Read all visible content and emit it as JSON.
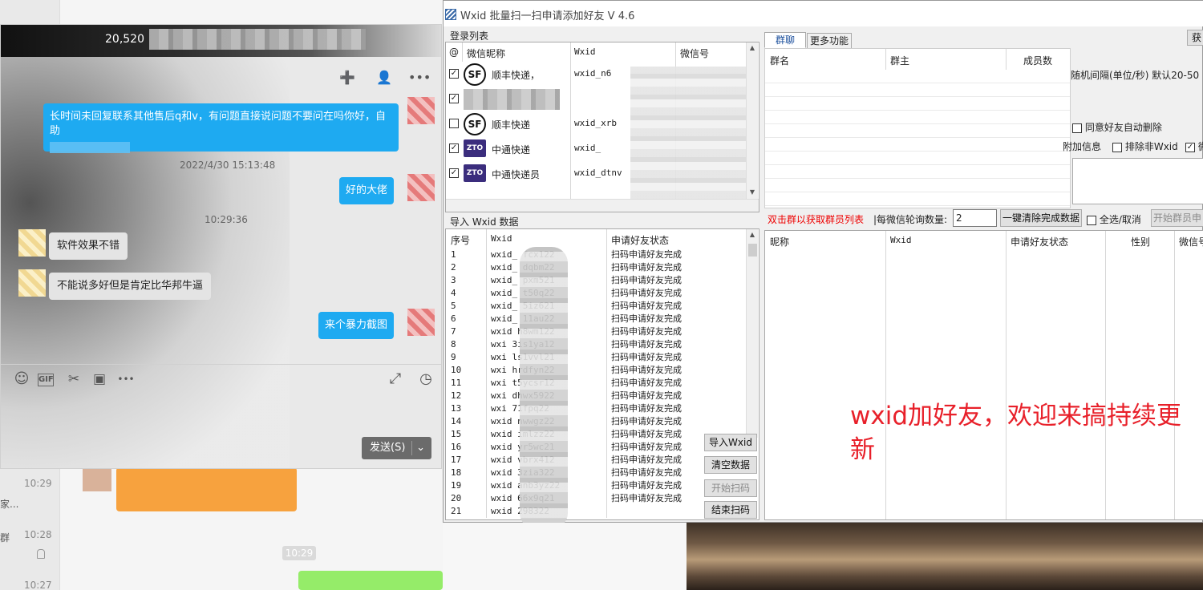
{
  "background_chat": {
    "times": [
      "10:29",
      "10:28",
      "10:27"
    ],
    "snippets": [
      "家...",
      "群"
    ],
    "pill_time": "10:29"
  },
  "chat": {
    "title": "20,520",
    "messages": [
      {
        "side": "right",
        "text": "长时间未回复联系其他售后q和v，有问题直接说问题不要问在吗你好，自助"
      },
      {
        "side": "stamp",
        "text": "2022/4/30 15:13:48"
      },
      {
        "side": "right",
        "text": "好的大佬"
      },
      {
        "side": "stamp",
        "text": "10:29:36"
      },
      {
        "side": "left",
        "text": "软件效果不错"
      },
      {
        "side": "left",
        "text": "不能说多好但是肯定比华邦牛逼"
      },
      {
        "side": "right",
        "text": "来个暴力截图"
      }
    ],
    "toolbar": {
      "emoji": "☺",
      "gif": "GIF",
      "scissors": "✂",
      "image": "▣",
      "more": "•••",
      "expand": "⤢",
      "history": "◷"
    },
    "header_icons": {
      "add_member": "➕",
      "profile": "👤",
      "more": "•••"
    },
    "send_label": "发送(S)",
    "send_arrow": "⌄"
  },
  "app": {
    "title": "Wxid 批量扫一扫申请添加好友 V 4.6",
    "login_list": {
      "label": "登录列表",
      "headers": [
        "@",
        "微信昵称",
        "Wxid",
        "微信号"
      ],
      "rows": [
        {
          "checked": true,
          "logo": "SF",
          "nick": "顺丰快递，",
          "wxid": "wxid_n6"
        },
        {
          "checked": true,
          "logo": "",
          "nick": "",
          "wxid": ""
        },
        {
          "checked": false,
          "logo": "SF",
          "nick": "顺丰快递",
          "wxid": "wxid_xrb"
        },
        {
          "checked": true,
          "logo": "ZTO",
          "nick": "中通快递",
          "wxid": "wxid_"
        },
        {
          "checked": true,
          "logo": "ZTO",
          "nick": "中通快递员",
          "wxid": "wxid_dtnv"
        }
      ]
    },
    "import": {
      "label": "导入 Wxid 数据",
      "headers": [
        "序号",
        "Wxid",
        "申请好友状态"
      ],
      "rows": [
        {
          "n": "1",
          "wxid": "wxid_      fcx122",
          "status": "扫码申请好友完成"
        },
        {
          "n": "2",
          "wxid": "wxid_      dqbm22",
          "status": "扫码申请好友完成"
        },
        {
          "n": "3",
          "wxid": "wxid_      pxm521",
          "status": "扫码申请好友完成"
        },
        {
          "n": "4",
          "wxid": "wxid_      t50q22",
          "status": "扫码申请好友完成"
        },
        {
          "n": "5",
          "wxid": "wxid_      5iz621",
          "status": "扫码申请好友完成"
        },
        {
          "n": "6",
          "wxid": "wxid_      11au22",
          "status": "扫码申请好友完成"
        },
        {
          "n": "7",
          "wxid": "wxid       h8wm122",
          "status": "扫码申请好友完成"
        },
        {
          "n": "8",
          "wxid": "wxi        3is1ya12",
          "status": "扫码申请好友完成"
        },
        {
          "n": "9",
          "wxid": "wxi        ls1vvl21",
          "status": "扫码申请好友完成"
        },
        {
          "n": "10",
          "wxid": "wxi       hrdfyn22",
          "status": "扫码申请好友完成"
        },
        {
          "n": "11",
          "wxid": "wxi       t5ycsr12",
          "status": "扫码申请好友完成"
        },
        {
          "n": "12",
          "wxid": "wxi       dhwx5922",
          "status": "扫码申请好友完成"
        },
        {
          "n": "13",
          "wxid": "wxi       71fpq22",
          "status": "扫码申请好友完成"
        },
        {
          "n": "14",
          "wxid": "wxid      nwwgz22",
          "status": "扫码申请好友完成"
        },
        {
          "n": "15",
          "wxid": "wxid      imlzz22",
          "status": "扫码申请好友完成"
        },
        {
          "n": "16",
          "wxid": "wxid      yr5wc21",
          "status": "扫码申请好友完成"
        },
        {
          "n": "17",
          "wxid": "wxid      vbrx412",
          "status": "扫码申请好友完成"
        },
        {
          "n": "18",
          "wxid": "wxid      3zia322",
          "status": "扫码申请好友完成"
        },
        {
          "n": "19",
          "wxid": "wxid      anb3yz22",
          "status": "扫码申请好友完成"
        },
        {
          "n": "20",
          "wxid": "wxid      66x9q21",
          "status": "扫码申请好友完成"
        },
        {
          "n": "21",
          "wxid": "wxid      298322",
          "status": ""
        }
      ],
      "buttons": {
        "import": "导入Wxid",
        "clear": "清空数据",
        "start": "开始扫码",
        "stop": "结束扫码"
      }
    },
    "tabs": [
      "群聊",
      "更多功能"
    ],
    "corner_button": "获",
    "group_table": {
      "headers": [
        "群名",
        "群主",
        "成员数"
      ]
    },
    "interval_label": "随机间隔(单位/秒) 默认20-50",
    "auto_delete_label": "同意好友自动删除",
    "extra_info_label": "附加信息",
    "exclude_label": "排除非Wxid",
    "wx_label": "微",
    "controls": {
      "hint": "双击群以获取群员列表",
      "poll_label": "|每微信轮询数量:",
      "poll_value": "2",
      "clear_done": "一键清除完成数据",
      "select_all": "全选/取消",
      "start_members": "开始群员申"
    },
    "member_table": {
      "headers": [
        "昵称",
        "Wxid",
        "申请好友状态",
        "性别",
        "微信号"
      ]
    }
  },
  "overlay_text": "wxid加好友，欢迎来搞持续更新",
  "colors": {
    "bubble_blue": "#1eaaf1",
    "red_text": "#e00000",
    "overlay_red": "#e8202a"
  }
}
